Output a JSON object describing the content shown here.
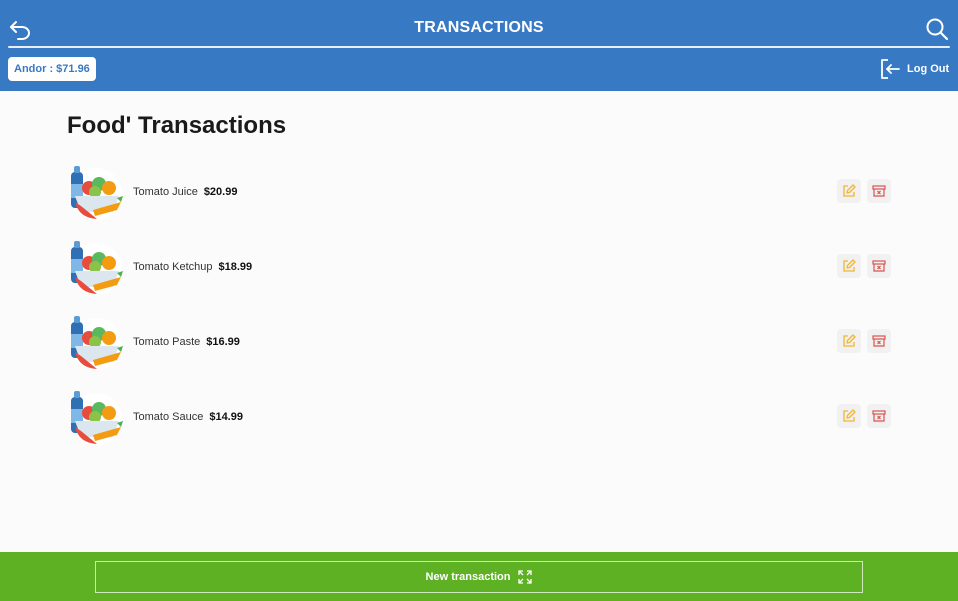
{
  "header": {
    "title": "TRANSACTIONS",
    "back_icon": "back-arrow-icon",
    "search_icon": "search-icon",
    "balance": "Andor : $71.96",
    "logout_label": "Log Out",
    "logout_icon": "logout-icon",
    "color": "#3879c3"
  },
  "main": {
    "title": "Food' Transactions",
    "items": [
      {
        "name": "Tomato Juice",
        "price": "$20.99",
        "icon": "food-basket-icon"
      },
      {
        "name": "Tomato Ketchup",
        "price": "$18.99",
        "icon": "food-basket-icon"
      },
      {
        "name": "Tomato Paste",
        "price": "$16.99",
        "icon": "food-basket-icon"
      },
      {
        "name": "Tomato Sauce",
        "price": "$14.99",
        "icon": "food-basket-icon"
      }
    ],
    "edit_icon": "edit-pencil-icon",
    "delete_icon": "delete-archive-icon",
    "edit_color": "#f2b632",
    "delete_color": "#d9534f"
  },
  "footer": {
    "new_transaction_label": "New transaction",
    "expand_icon": "expand-icon",
    "color": "#5db122"
  }
}
